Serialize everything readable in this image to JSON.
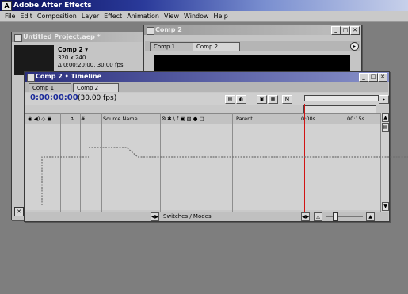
{
  "app": {
    "title": "Adobe After Effects",
    "logo": "A",
    "menu": [
      "File",
      "Edit",
      "Composition",
      "Layer",
      "Effect",
      "Animation",
      "View",
      "Window",
      "Help"
    ]
  },
  "project": {
    "window_title": "Untitled Project.aep *",
    "comp_name": "Comp 2 ▾",
    "dimensions": "320 x 240",
    "duration": "Δ 0:00:20:00, 30.00 fps"
  },
  "comp_window": {
    "title": "Comp 2",
    "tabs": [
      "Comp 1",
      "Comp 2"
    ]
  },
  "timeline": {
    "title": "Comp 2 • Timeline",
    "tabs": [
      "Comp 1",
      "Comp 2"
    ],
    "timecode": "0:00:00:00",
    "fps": "(30.00 fps)",
    "columns": {
      "av": "◉ ◀) ◇ ▣",
      "label": "↴",
      "num": "#",
      "source": "Source Name",
      "switches": "⭙ ✱ \\ f ▣ ▧ ● □",
      "parent": "Parent",
      "t0": "0:00s",
      "t1": "00:15s"
    },
    "switches_modes": "Switches / Modes"
  },
  "colors": {
    "active_title": "#2b2f7e",
    "time_indicator": "#d11414",
    "timecode": "#1a2a9a"
  }
}
